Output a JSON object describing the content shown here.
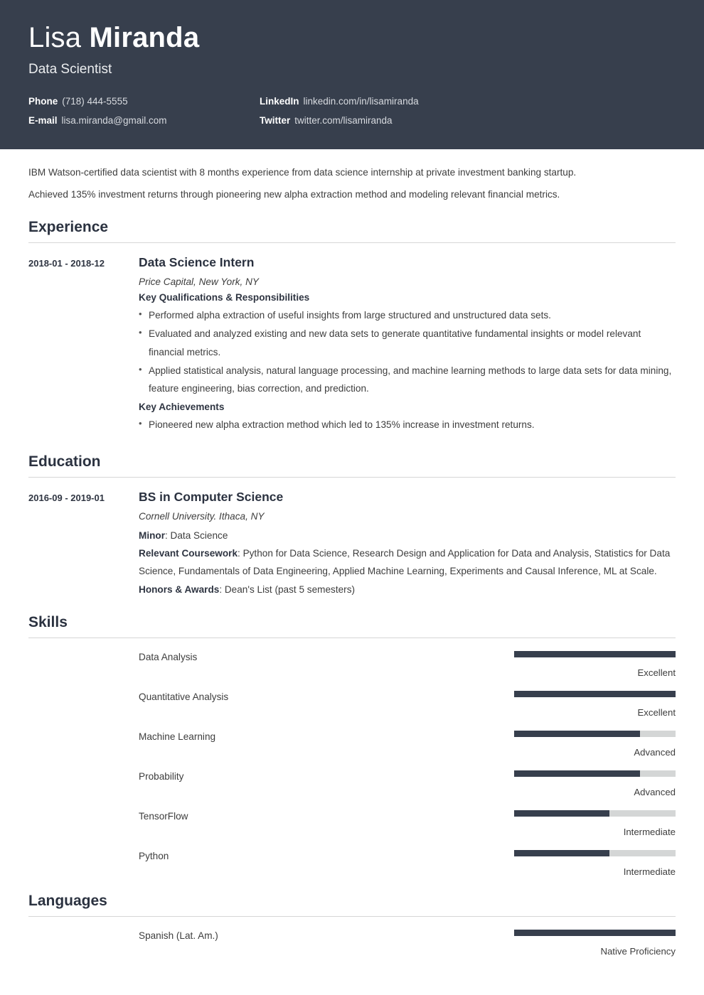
{
  "theme": {
    "header_bg": "#373f4d",
    "accent": "#373f4d",
    "meter_track": "#d4d6d6",
    "rule": "#d6d6d6",
    "body_text": "#3d3d3d"
  },
  "header": {
    "first_name": "Lisa ",
    "last_name": "Miranda",
    "job_title": "Data Scientist",
    "contacts": [
      {
        "label": "Phone",
        "value": "(718) 444-5555"
      },
      {
        "label": "LinkedIn",
        "value": "linkedin.com/in/lisamiranda"
      },
      {
        "label": "E-mail",
        "value": "lisa.miranda@gmail.com"
      },
      {
        "label": "Twitter",
        "value": "twitter.com/lisamiranda"
      }
    ]
  },
  "summary": {
    "line1": "IBM Watson-certified data scientist with 8 months experience from data science internship at private investment banking startup.",
    "line2": "Achieved 135% investment returns through pioneering new alpha extraction method and modeling relevant financial metrics."
  },
  "experience": {
    "section_title": "Experience",
    "entries": [
      {
        "date": "2018-01 - 2018-12",
        "title": "Data Science Intern",
        "subtitle": "Price Capital, New York, NY",
        "group1_heading": "Key Qualifications & Responsibilities",
        "group1_bullets": [
          "Performed alpha extraction of useful insights from large structured and unstructured data sets.",
          "Evaluated and analyzed existing and new data sets to generate quantitative fundamental insights or model relevant financial metrics.",
          "Applied statistical analysis, natural language processing, and machine learning methods to large data sets for data mining, feature engineering, bias correction, and prediction."
        ],
        "group2_heading": "Key Achievements",
        "group2_bullets": [
          "Pioneered new alpha extraction method which led to 135% increase in investment returns."
        ]
      }
    ]
  },
  "education": {
    "section_title": "Education",
    "entries": [
      {
        "date": "2016-09 - 2019-01",
        "title": "BS in Computer Science",
        "subtitle": "Cornell University. Ithaca, NY",
        "minor_label": "Minor",
        "minor_value": ": Data Science",
        "coursework_label": "Relevant Coursework",
        "coursework_value": ": Python for Data Science, Research Design and Application for Data and Analysis, Statistics for Data Science, Fundamentals of Data Engineering, Applied Machine Learning, Experiments and Causal Inference, ML at Scale.",
        "honors_label": "Honors & Awards",
        "honors_value": ": Dean's List (past 5 semesters)"
      }
    ]
  },
  "skills": {
    "section_title": "Skills",
    "items": [
      {
        "name": "Data Analysis",
        "level_label": "Excellent",
        "percent": 100
      },
      {
        "name": "Quantitative Analysis",
        "level_label": "Excellent",
        "percent": 100
      },
      {
        "name": "Machine Learning",
        "level_label": "Advanced",
        "percent": 78
      },
      {
        "name": "Probability",
        "level_label": "Advanced",
        "percent": 78
      },
      {
        "name": "TensorFlow",
        "level_label": "Intermediate",
        "percent": 59
      },
      {
        "name": "Python",
        "level_label": "Intermediate",
        "percent": 59
      }
    ]
  },
  "languages": {
    "section_title": "Languages",
    "items": [
      {
        "name": "Spanish (Lat. Am.)",
        "level_label": "Native Proficiency",
        "percent": 100
      }
    ]
  }
}
